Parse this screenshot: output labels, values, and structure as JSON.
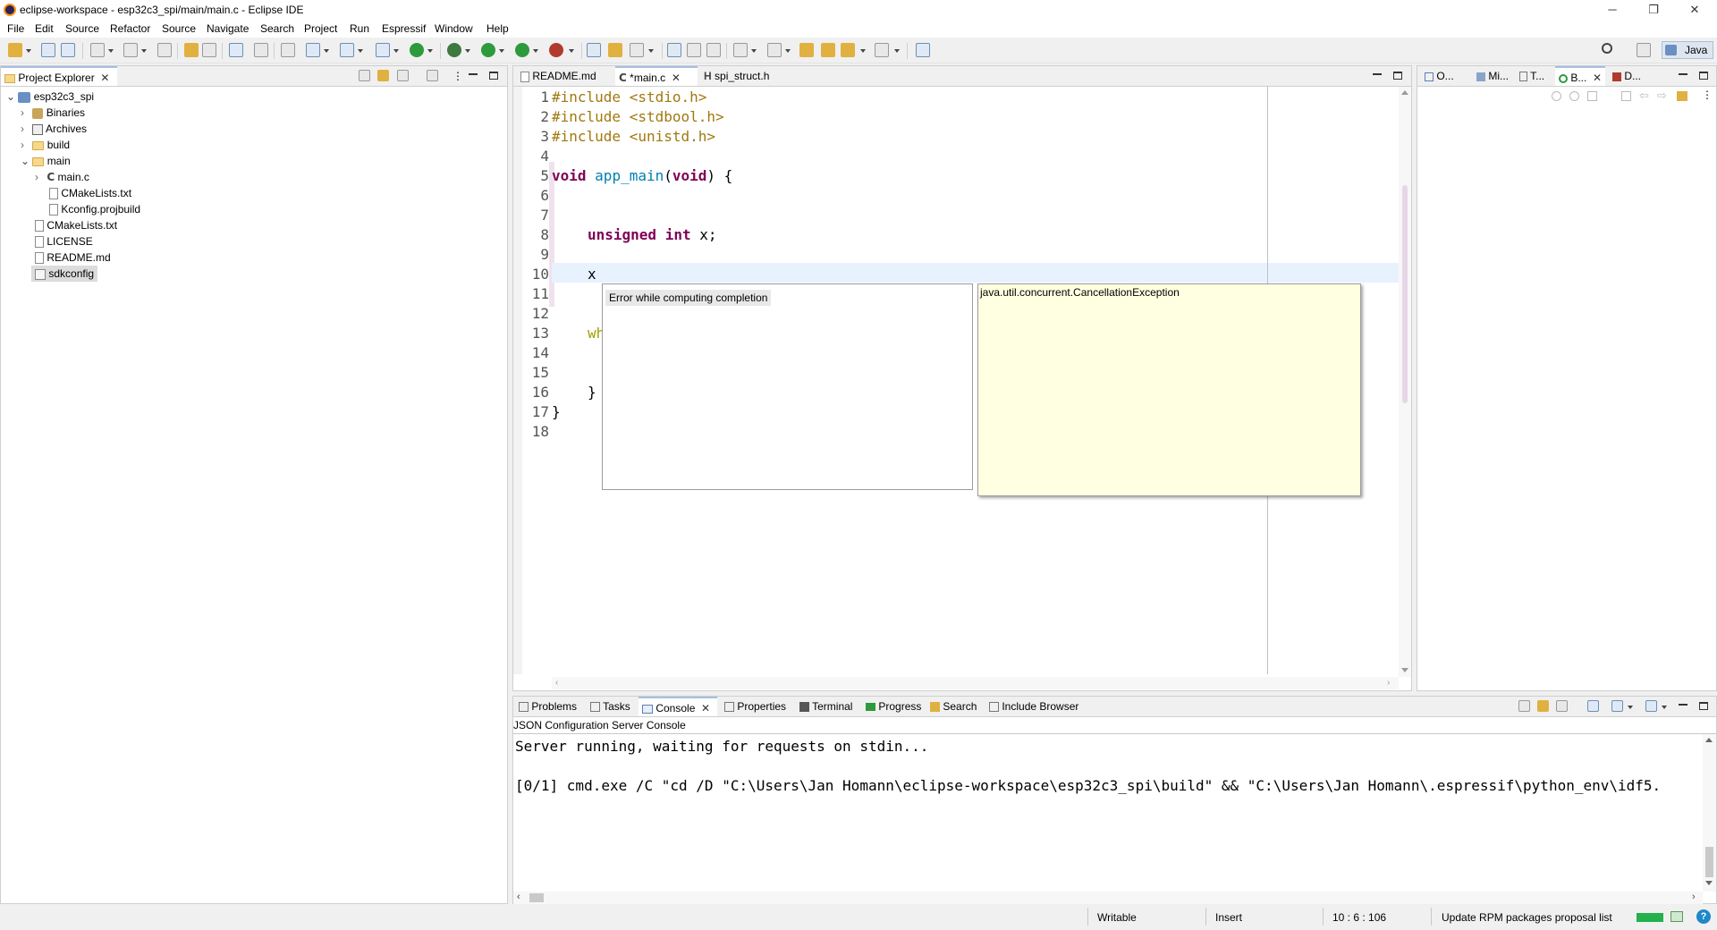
{
  "window": {
    "title": "eclipse-workspace - esp32c3_spi/main/main.c - Eclipse IDE",
    "minimize": "─",
    "restore": "❐",
    "close": "✕"
  },
  "menu": [
    "File",
    "Edit",
    "Source",
    "Refactor",
    "Source",
    "Navigate",
    "Search",
    "Project",
    "Run",
    "Espressif",
    "Window",
    "Help"
  ],
  "perspective": {
    "label": "Java"
  },
  "project_explorer": {
    "title": "Project Explorer",
    "items": [
      {
        "label": "esp32c3_spi"
      },
      {
        "label": "Binaries"
      },
      {
        "label": "Archives"
      },
      {
        "label": "build"
      },
      {
        "label": "main"
      },
      {
        "label": "main.c"
      },
      {
        "label": "CMakeLists.txt"
      },
      {
        "label": "Kconfig.projbuild"
      },
      {
        "label": "CMakeLists.txt"
      },
      {
        "label": "LICENSE"
      },
      {
        "label": "README.md"
      },
      {
        "label": "sdkconfig"
      }
    ]
  },
  "editor": {
    "tabs": [
      {
        "label": "README.md"
      },
      {
        "label": "*main.c"
      },
      {
        "label": "spi_struct.h"
      }
    ],
    "line_numbers": [
      "1",
      "2",
      "3",
      "4",
      "5",
      "6",
      "7",
      "8",
      "9",
      "10",
      "11",
      "12",
      "13",
      "14",
      "15",
      "16",
      "17",
      "18"
    ],
    "code": {
      "l1": "#include <stdio.h>",
      "l2": "#include <stdbool.h>",
      "l3": "#include <unistd.h>",
      "l5_void": "void",
      "l5_fn": "app_main",
      "l5_paren": "(",
      "l5_arg": "void",
      "l5_rest": ") {",
      "l8_unsigned": "unsigned",
      "l8_int": "int",
      "l8_rest": " x;",
      "l10": "x",
      "l13": "wh",
      "l16": "}",
      "l17": "}"
    }
  },
  "completion": {
    "item": "Error while computing completion",
    "info": "java.util.concurrent.CancellationException"
  },
  "right_panel": {
    "tabs": [
      {
        "label": "O..."
      },
      {
        "label": "Mi..."
      },
      {
        "label": "T..."
      },
      {
        "label": "B..."
      },
      {
        "label": "D..."
      }
    ]
  },
  "bottom_panel": {
    "tabs": [
      {
        "label": "Problems"
      },
      {
        "label": "Tasks"
      },
      {
        "label": "Console"
      },
      {
        "label": "Properties"
      },
      {
        "label": "Terminal"
      },
      {
        "label": "Progress"
      },
      {
        "label": "Search"
      },
      {
        "label": "Include Browser"
      }
    ],
    "console_title": "JSON Configuration Server Console",
    "lines": [
      "Server running, waiting for requests on stdin...",
      "[0/1] cmd.exe /C \"cd /D \"C:\\Users\\Jan Homann\\eclipse-workspace\\esp32c3_spi\\build\" && \"C:\\Users\\Jan Homann\\.espressif\\python_env\\idf5."
    ]
  },
  "status": {
    "writable": "Writable",
    "insert": "Insert",
    "position": "10 : 6 : 106",
    "task": "Update RPM packages proposal list",
    "help": "?"
  },
  "colors": {
    "keyword": "#7f0055",
    "preprocessor": "#a0790d",
    "function": "#007fb0",
    "tooltip_bg": "#ffffe1",
    "highlight_line": "#e8f2fe"
  }
}
